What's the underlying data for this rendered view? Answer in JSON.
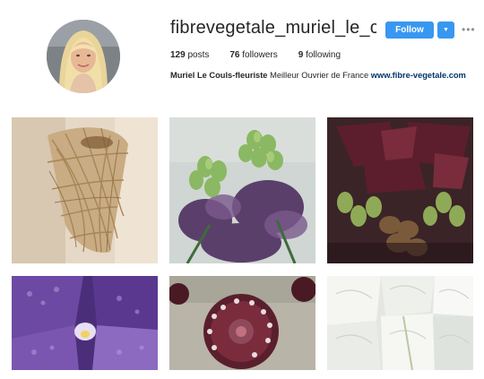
{
  "profile": {
    "username": "fibrevegetale_muriel_le_c...",
    "follow_label": "Follow",
    "more_icon": "ellipsis-icon",
    "dropdown_icon": "caret-down-icon",
    "avatar": "profile-photo"
  },
  "stats": {
    "posts_count": "129",
    "posts_label": "posts",
    "followers_count": "76",
    "followers_label": "followers",
    "following_count": "9",
    "following_label": "following"
  },
  "bio": {
    "name": "Muriel Le Couls-fleuriste",
    "text": "Meilleur Ouvrier de France",
    "link": "www.fibre-vegetale.com"
  },
  "colors": {
    "accent": "#3897f0",
    "link": "#003569",
    "muted": "#8e8e8e"
  },
  "posts": [
    {
      "subject": "woven-twig-basket-photo"
    },
    {
      "subject": "fritillaria-flowers-photo"
    },
    {
      "subject": "dark-fritillaria-photo"
    },
    {
      "subject": "purple-orchid-photo"
    },
    {
      "subject": "burgundy-dahlia-photo"
    },
    {
      "subject": "white-sweet-pea-photo"
    }
  ]
}
